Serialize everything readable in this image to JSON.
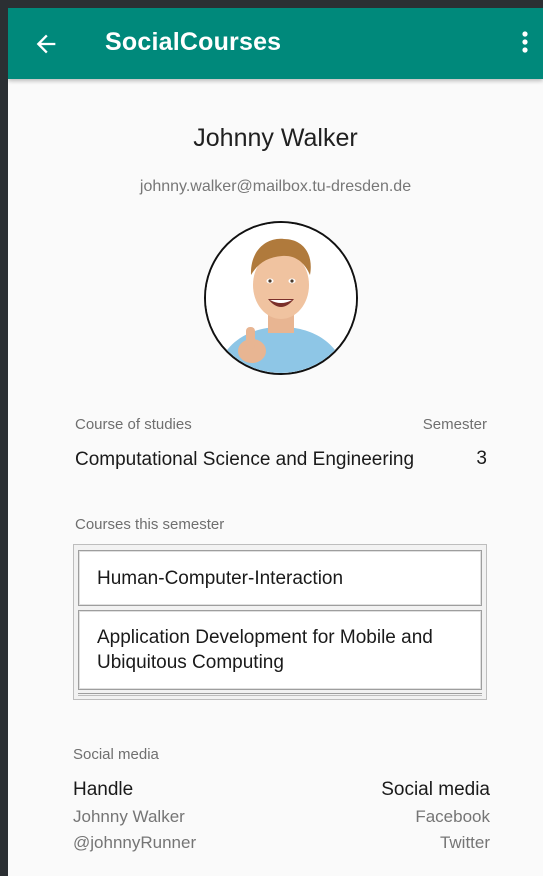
{
  "appbar": {
    "title": "SocialCourses",
    "back_icon": "arrow-left-icon",
    "menu_icon": "more-vert-icon",
    "color": "#00897b"
  },
  "profile": {
    "name": "Johnny Walker",
    "email": "johnny.walker@mailbox.tu-dresden.de"
  },
  "studies": {
    "course_label": "Course of studies",
    "course_value": "Computational Science and Engineering",
    "semester_label": "Semester",
    "semester_value": "3"
  },
  "courses": {
    "label": "Courses this semester",
    "items": [
      "Human-Computer-Interaction",
      "Application Development for Mobile and Ubiquitous Computing"
    ]
  },
  "social": {
    "section_label": "Social media",
    "handle_header": "Handle",
    "media_header": "Social media",
    "rows": [
      {
        "handle": "Johnny Walker",
        "media": "Facebook"
      },
      {
        "handle": "@johnnyRunner",
        "media": "Twitter"
      }
    ]
  }
}
